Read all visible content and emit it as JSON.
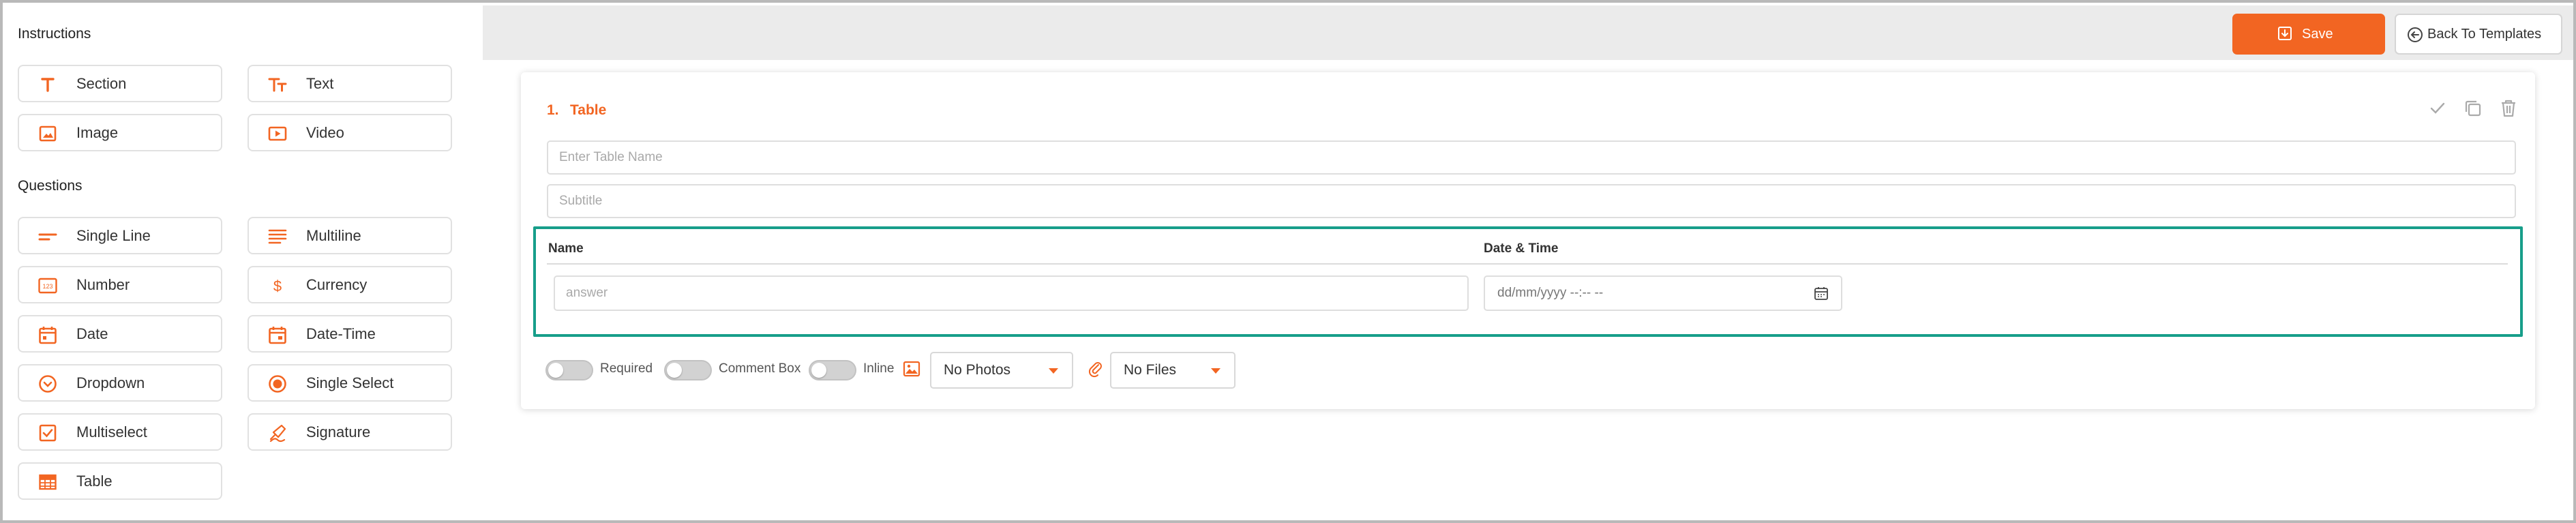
{
  "sidebar": {
    "instructions_title": "Instructions",
    "questions_title": "Questions",
    "instructions": [
      {
        "label": "Section",
        "icon": "section-icon"
      },
      {
        "label": "Text",
        "icon": "text-icon"
      },
      {
        "label": "Image",
        "icon": "image-icon"
      },
      {
        "label": "Video",
        "icon": "video-icon"
      }
    ],
    "questions": [
      {
        "label": "Single Line",
        "icon": "single-line-icon"
      },
      {
        "label": "Multiline",
        "icon": "multiline-icon"
      },
      {
        "label": "Number",
        "icon": "number-icon"
      },
      {
        "label": "Currency",
        "icon": "currency-icon"
      },
      {
        "label": "Date",
        "icon": "calendar-icon"
      },
      {
        "label": "Date-Time",
        "icon": "calendar-clock-icon"
      },
      {
        "label": "Dropdown",
        "icon": "dropdown-icon"
      },
      {
        "label": "Single Select",
        "icon": "radio-icon"
      },
      {
        "label": "Multiselect",
        "icon": "checkbox-icon"
      },
      {
        "label": "Signature",
        "icon": "signature-icon"
      },
      {
        "label": "Table",
        "icon": "table-icon"
      }
    ],
    "number_icon_text": "123",
    "currency_icon_text": "$"
  },
  "toolbar": {
    "save_label": "Save",
    "back_label": "Back To Templates"
  },
  "question": {
    "number": "1.",
    "title": "Table",
    "table_name_placeholder": "Enter Table Name",
    "subtitle_placeholder": "Subtitle",
    "columns": [
      {
        "header": "Name",
        "placeholder": "answer"
      },
      {
        "header": "Date & Time",
        "value": "dd/mm/yyyy --:-- --"
      }
    ]
  },
  "options": {
    "required_label": "Required",
    "comment_label": "Comment Box",
    "inline_label": "Inline",
    "photos_select": "No Photos",
    "files_select": "No Files",
    "required_on": false,
    "comment_on": false,
    "inline_on": false
  },
  "colors": {
    "accent": "#f26522",
    "highlight_border": "#179e8a",
    "topbar_bg": "#ebebeb"
  }
}
